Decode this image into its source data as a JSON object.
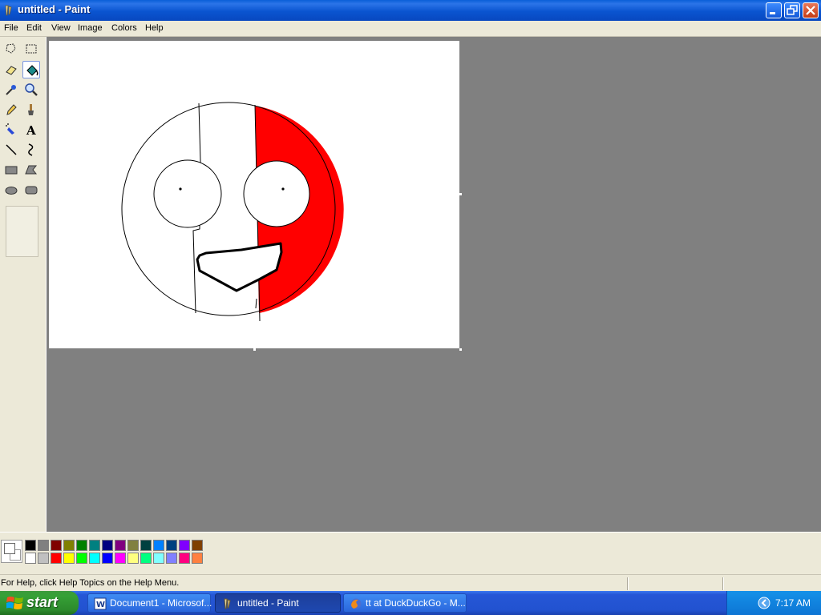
{
  "window": {
    "title": "untitled - Paint"
  },
  "menu": {
    "items": [
      "File",
      "Edit",
      "View",
      "Image",
      "Colors",
      "Help"
    ]
  },
  "tools": [
    {
      "name": "free-form-select-icon"
    },
    {
      "name": "select-icon"
    },
    {
      "name": "eraser-icon"
    },
    {
      "name": "fill-with-color-icon",
      "selected": true
    },
    {
      "name": "pick-color-icon"
    },
    {
      "name": "magnifier-icon"
    },
    {
      "name": "pencil-icon"
    },
    {
      "name": "brush-icon"
    },
    {
      "name": "airbrush-icon"
    },
    {
      "name": "text-icon"
    },
    {
      "name": "line-icon"
    },
    {
      "name": "curve-icon"
    },
    {
      "name": "rectangle-icon"
    },
    {
      "name": "polygon-icon"
    },
    {
      "name": "ellipse-icon"
    },
    {
      "name": "rounded-rectangle-icon"
    }
  ],
  "palette": {
    "top": [
      "#000000",
      "#808080",
      "#800000",
      "#808000",
      "#008000",
      "#008080",
      "#000080",
      "#800080",
      "#808040",
      "#004040",
      "#0080ff",
      "#004080",
      "#8000ff",
      "#804000"
    ],
    "bottom": [
      "#ffffff",
      "#c0c0c0",
      "#ff0000",
      "#ffff00",
      "#00ff00",
      "#00ffff",
      "#0000ff",
      "#ff00ff",
      "#ffff80",
      "#00ff80",
      "#80ffff",
      "#8080ff",
      "#ff0080",
      "#ff8040"
    ],
    "foreground": "#ffffff",
    "background": "#ffffff"
  },
  "status": {
    "help_text": "For Help, click Help Topics on the Help Menu."
  },
  "taskbar": {
    "start_label": "start",
    "tasks": [
      {
        "label": "Document1 - Microsof...",
        "icon": "word-icon"
      },
      {
        "label": "untitled - Paint",
        "icon": "paint-icon",
        "active": true
      },
      {
        "label": "tt at DuckDuckGo - M...",
        "icon": "firefox-icon"
      }
    ],
    "clock": "7:17 AM"
  },
  "drawing": {
    "fill_color": "#ff0000",
    "stroke_color": "#000000"
  }
}
